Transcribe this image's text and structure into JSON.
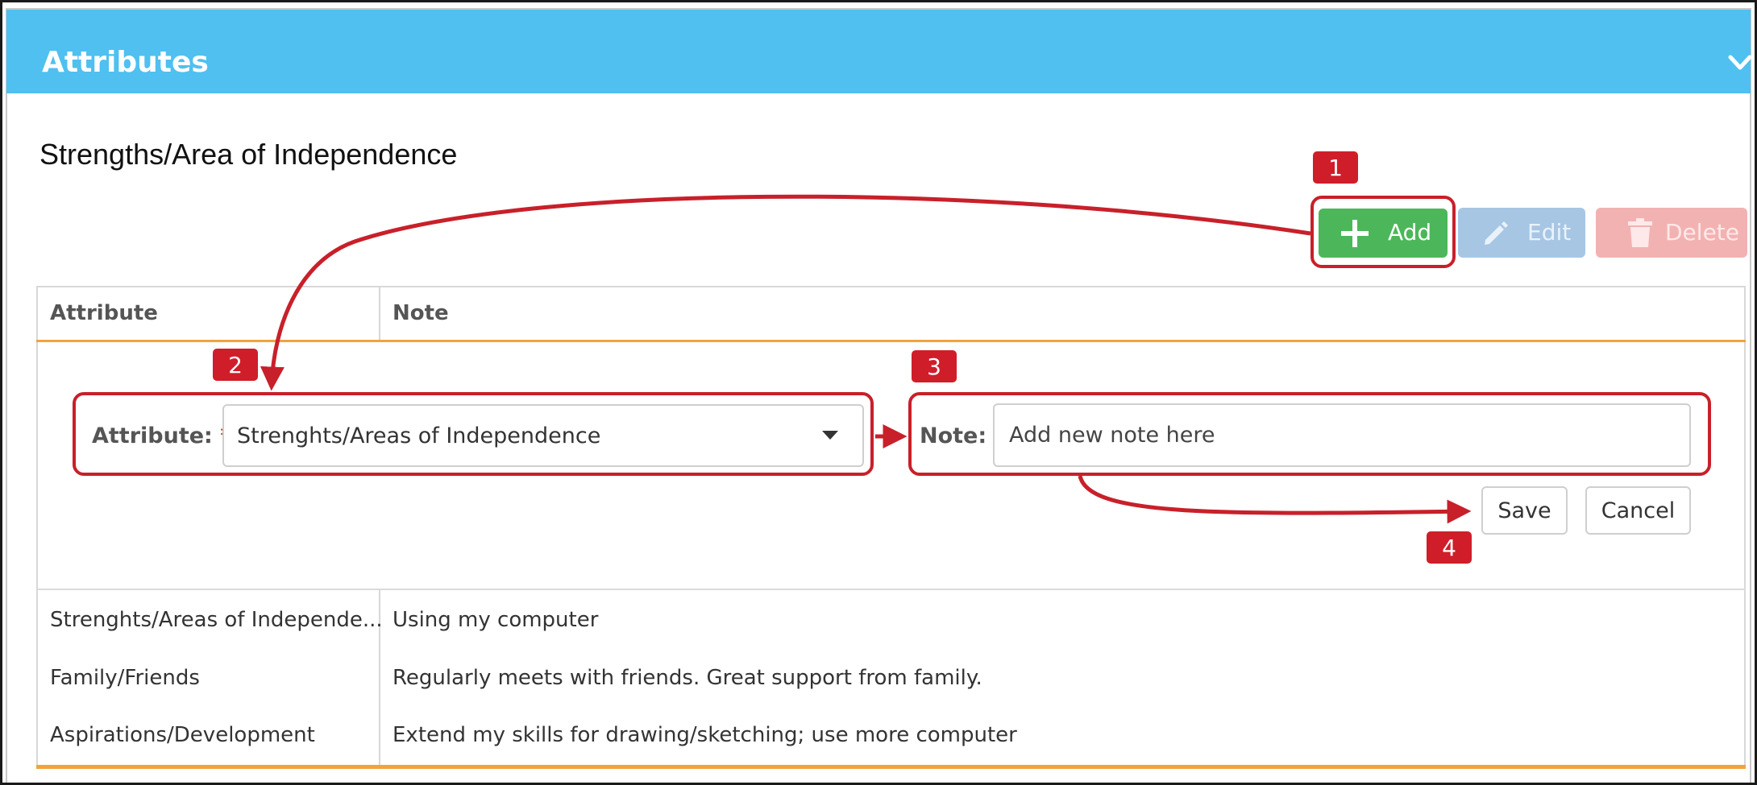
{
  "panel": {
    "title": "Attributes"
  },
  "section": {
    "title": "Strengths/Area of Independence"
  },
  "toolbar": {
    "add_label": "Add",
    "edit_label": "Edit",
    "delete_label": "Delete"
  },
  "table": {
    "headers": [
      "Attribute",
      "Note"
    ],
    "rows": [
      {
        "attribute": "Strenghts/Areas of Independe...",
        "note": "Using my computer"
      },
      {
        "attribute": "Family/Friends",
        "note": "Regularly meets with friends. Great support from family."
      },
      {
        "attribute": "Aspirations/Development",
        "note": "Extend my skills for drawing/sketching; use more computer"
      }
    ]
  },
  "form": {
    "attribute_label": "Attribute:",
    "required_mark": "*",
    "attribute_value": "Strenghts/Areas of Independence",
    "note_label": "Note:",
    "note_value": "",
    "note_placeholder": "Add new note here",
    "save_label": "Save",
    "cancel_label": "Cancel"
  },
  "callouts": [
    "1",
    "2",
    "3",
    "4"
  ],
  "icons": {
    "collapse": "chevron-down-icon",
    "add": "plus-icon",
    "edit": "pencil-icon",
    "delete": "trash-icon",
    "dropdown": "caret-down-icon"
  },
  "colors": {
    "header": "#4fc0f0",
    "add": "#4cb75a",
    "edit_disabled": "#a7c6e4",
    "delete_disabled": "#f3b2b2",
    "accent_line": "#f3a23c",
    "annotation": "#c8202a"
  }
}
